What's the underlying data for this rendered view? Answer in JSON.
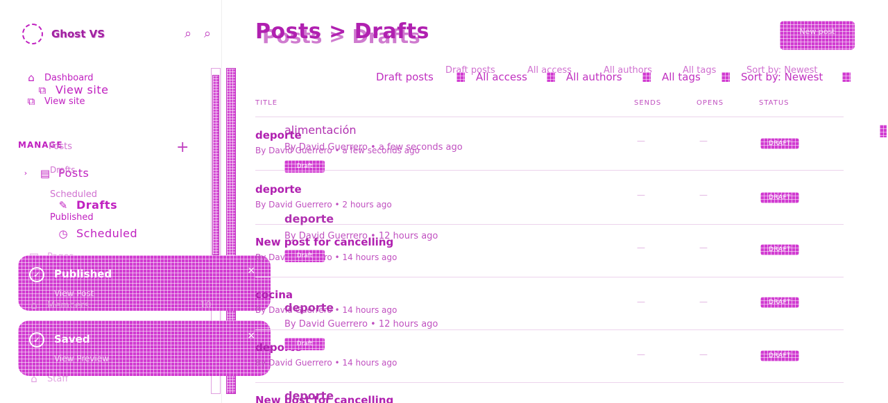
{
  "brand": {
    "name": "Ghost VS"
  },
  "icons": {
    "search": "⌕",
    "plus": "+",
    "home": "⌂",
    "external": "⧉",
    "posts": "▤",
    "draft": "✎",
    "clock": "◷",
    "check": "✓",
    "close": "×",
    "chevron": "›"
  },
  "sidebar": {
    "dashboard": "Dashboard",
    "view_site": "View site",
    "view_site_ghost": "View site",
    "manage": "MANAGE",
    "posts": "Posts",
    "posts_ghost": "Posts",
    "drafts": "Drafts",
    "drafts_ghost": "Drafts",
    "scheduled": "Scheduled",
    "scheduled_ghost": "Scheduled",
    "published": "Published",
    "pages": "Pages",
    "members": "Members",
    "members_count": "10",
    "staff": "Staff"
  },
  "toasts": [
    {
      "title": "Published",
      "link": "View Post"
    },
    {
      "title": "Saved",
      "link": "View Preview"
    }
  ],
  "breadcrumb": {
    "root": "Posts",
    "separator": ">",
    "current": "Drafts"
  },
  "new_post_button": "New post",
  "filters": {
    "type": "Draft posts",
    "access": "All access",
    "authors": "All authors",
    "tags": "All tags",
    "sort": "Sort by: Newest"
  },
  "columns": {
    "title": "TITLE",
    "sends": "SENDS",
    "opens": "OPENS",
    "status": "STATUS"
  },
  "posts": [
    {
      "title": "deporte",
      "meta": "By David Guerrero • a few seconds ago",
      "status": "DRAFT"
    },
    {
      "title": "deporte",
      "meta": "By David Guerrero • 2 hours ago",
      "status": "DRAFT"
    },
    {
      "title": "New post for cancelling",
      "meta": "By David Guerrero • 14 hours ago",
      "status": "DRAFT"
    },
    {
      "title": "cocina",
      "meta": "By David Guerrero • 14 hours ago",
      "status": "DRAFT"
    },
    {
      "title": "deporte",
      "meta": "By David Guerrero • 14 hours ago",
      "status": "DRAFT"
    },
    {
      "title": "New post for cancelling",
      "meta": "",
      "status": "DRAFT"
    }
  ],
  "overlay_posts": [
    {
      "title": "alimentación",
      "meta": "By David Guerrero • a few seconds ago",
      "status": "Draft"
    },
    {
      "title": "deporte",
      "meta": "By David Guerrero • 12 hours ago",
      "status": "Draft"
    },
    {
      "title": "deporte",
      "meta": "By David Guerrero • 12 hours ago",
      "status": "Draft"
    },
    {
      "title": "deporte"
    }
  ],
  "placeholder_dash": "—",
  "colors": {
    "accent": "#c020c0",
    "mesh": "#d13bd1"
  }
}
